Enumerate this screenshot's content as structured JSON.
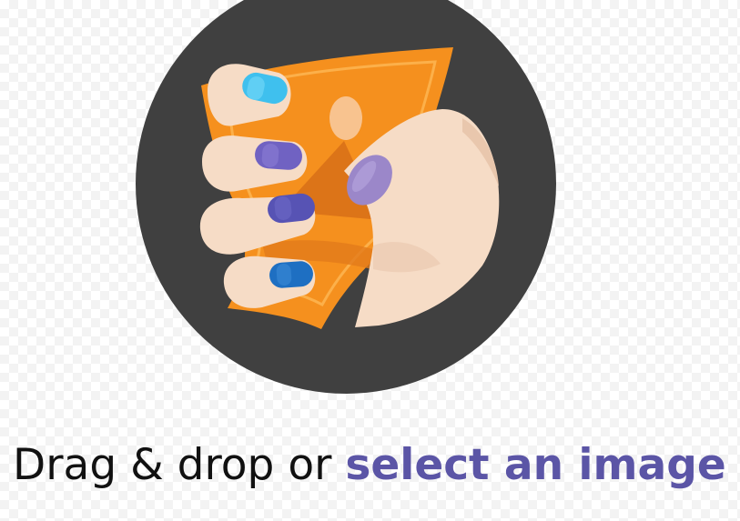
{
  "dropzone": {
    "prompt_prefix": "Drag & drop or ",
    "select_link": "select an image",
    "hint": ""
  },
  "illustration": {
    "icon": "hand-holding-cash-icon"
  },
  "colors": {
    "background_checker": "#f3f3f3",
    "circle": "#404040",
    "link": "#5b55a6",
    "text": "#111111",
    "banknote": "#f5901e",
    "skin": "#f6dcc6"
  }
}
